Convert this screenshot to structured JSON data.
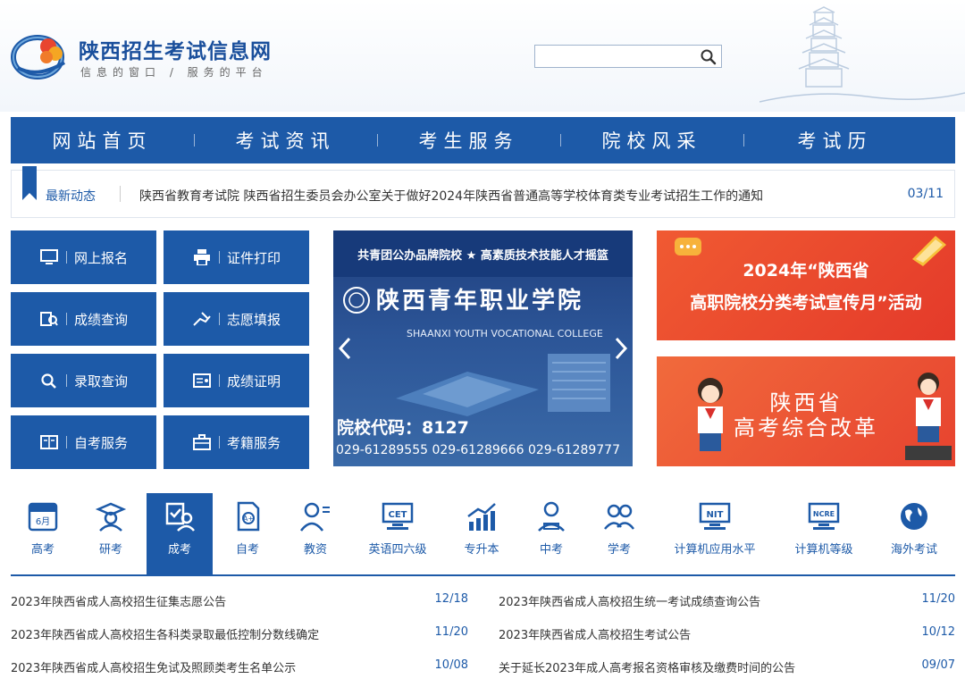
{
  "header": {
    "title": "陕西招生考试信息网",
    "slogan": "信息的窗口 / 服务的平台",
    "search_placeholder": ""
  },
  "nav": {
    "items": [
      "网站首页",
      "考试资讯",
      "考生服务",
      "院校风采",
      "考试历"
    ]
  },
  "ticker": {
    "label": "最新动态",
    "text": "陕西省教育考试院 陕西省招生委员会办公室关于做好2024年陕西省普通高等学校体育类专业考试招生工作的通知",
    "date": "03/11"
  },
  "tiles": [
    {
      "label": "网上报名",
      "icon": "monitor-icon"
    },
    {
      "label": "证件打印",
      "icon": "printer-icon"
    },
    {
      "label": "成绩查询",
      "icon": "score-search-icon"
    },
    {
      "label": "志愿填报",
      "icon": "hand-write-icon"
    },
    {
      "label": "录取查询",
      "icon": "search-icon"
    },
    {
      "label": "成绩证明",
      "icon": "certificate-icon"
    },
    {
      "label": "自考服务",
      "icon": "book-icon"
    },
    {
      "label": "考籍服务",
      "icon": "briefcase-icon"
    }
  ],
  "carousel": {
    "top_text": "共青团公办品牌院校 ★ 高素质技术技能人才摇篮",
    "college_cn": "陕西青年职业学院",
    "college_en": "SHAANXI YOUTH VOCATIONAL COLLEGE",
    "code_text": "院校代码：8127",
    "phones": "029-61289555  029-61289666  029-61289777"
  },
  "banners": {
    "b1_line1": "2024年“陕西省",
    "b1_line2": "高职院校分类考试宣传月”活动",
    "b2_line1": "陕西省",
    "b2_line2": "高考综合改革"
  },
  "categories": [
    {
      "label": "高考",
      "icon": "calendar-exam-icon",
      "active": false
    },
    {
      "label": "研考",
      "icon": "graduate-icon",
      "active": false
    },
    {
      "label": "成考",
      "icon": "adult-exam-icon",
      "active": true
    },
    {
      "label": "自考",
      "icon": "self-study-icon",
      "active": false
    },
    {
      "label": "教资",
      "icon": "teacher-icon",
      "active": false
    },
    {
      "label": "英语四六级",
      "icon": "cet-icon",
      "active": false
    },
    {
      "label": "专升本",
      "icon": "growth-chart-icon",
      "active": false
    },
    {
      "label": "中考",
      "icon": "student-reading-icon",
      "active": false
    },
    {
      "label": "学考",
      "icon": "students-icon",
      "active": false
    },
    {
      "label": "计算机应用水平",
      "icon": "nit-icon",
      "active": false
    },
    {
      "label": "计算机等级",
      "icon": "ncre-icon",
      "active": false
    },
    {
      "label": "海外考试",
      "icon": "globe-icon",
      "active": false
    }
  ],
  "news_left": [
    {
      "title": "2023年陕西省成人高校招生征集志愿公告",
      "date": "12/18"
    },
    {
      "title": "2023年陕西省成人高校招生各科类录取最低控制分数线确定",
      "date": "11/20"
    },
    {
      "title": "2023年陕西省成人高校招生免试及照顾类考生名单公示",
      "date": "10/08"
    }
  ],
  "news_right": [
    {
      "title": "2023年陕西省成人高校招生统一考试成绩查询公告",
      "date": "11/20"
    },
    {
      "title": "2023年陕西省成人高校招生考试公告",
      "date": "10/12"
    },
    {
      "title": "关于延长2023年成人高考报名资格审核及缴费时间的公告",
      "date": "09/07"
    }
  ],
  "colors": {
    "primary": "#1d5aa8",
    "banner_red": "#e8452f"
  }
}
